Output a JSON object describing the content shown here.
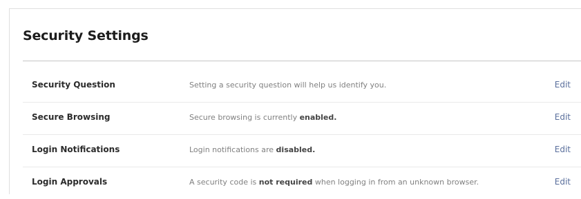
{
  "page": {
    "title": "Security Settings"
  },
  "colors": {
    "link": "#5a6f9c",
    "row_label": "#2b2b2b",
    "description": "#808080",
    "divider": "#e9e9e9"
  },
  "settings": [
    {
      "label": "Security Question",
      "desc_before": "Setting a security question will help us identify you.",
      "desc_bold": "",
      "desc_after": "",
      "action": "Edit"
    },
    {
      "label": "Secure Browsing",
      "desc_before": "Secure browsing is currently ",
      "desc_bold": "enabled.",
      "desc_after": "",
      "action": "Edit"
    },
    {
      "label": "Login Notifications",
      "desc_before": "Login notifications are ",
      "desc_bold": "disabled.",
      "desc_after": "",
      "action": "Edit"
    },
    {
      "label": "Login Approvals",
      "desc_before": "A security code is ",
      "desc_bold": "not required",
      "desc_after": " when logging in from an unknown browser.",
      "action": "Edit"
    }
  ]
}
